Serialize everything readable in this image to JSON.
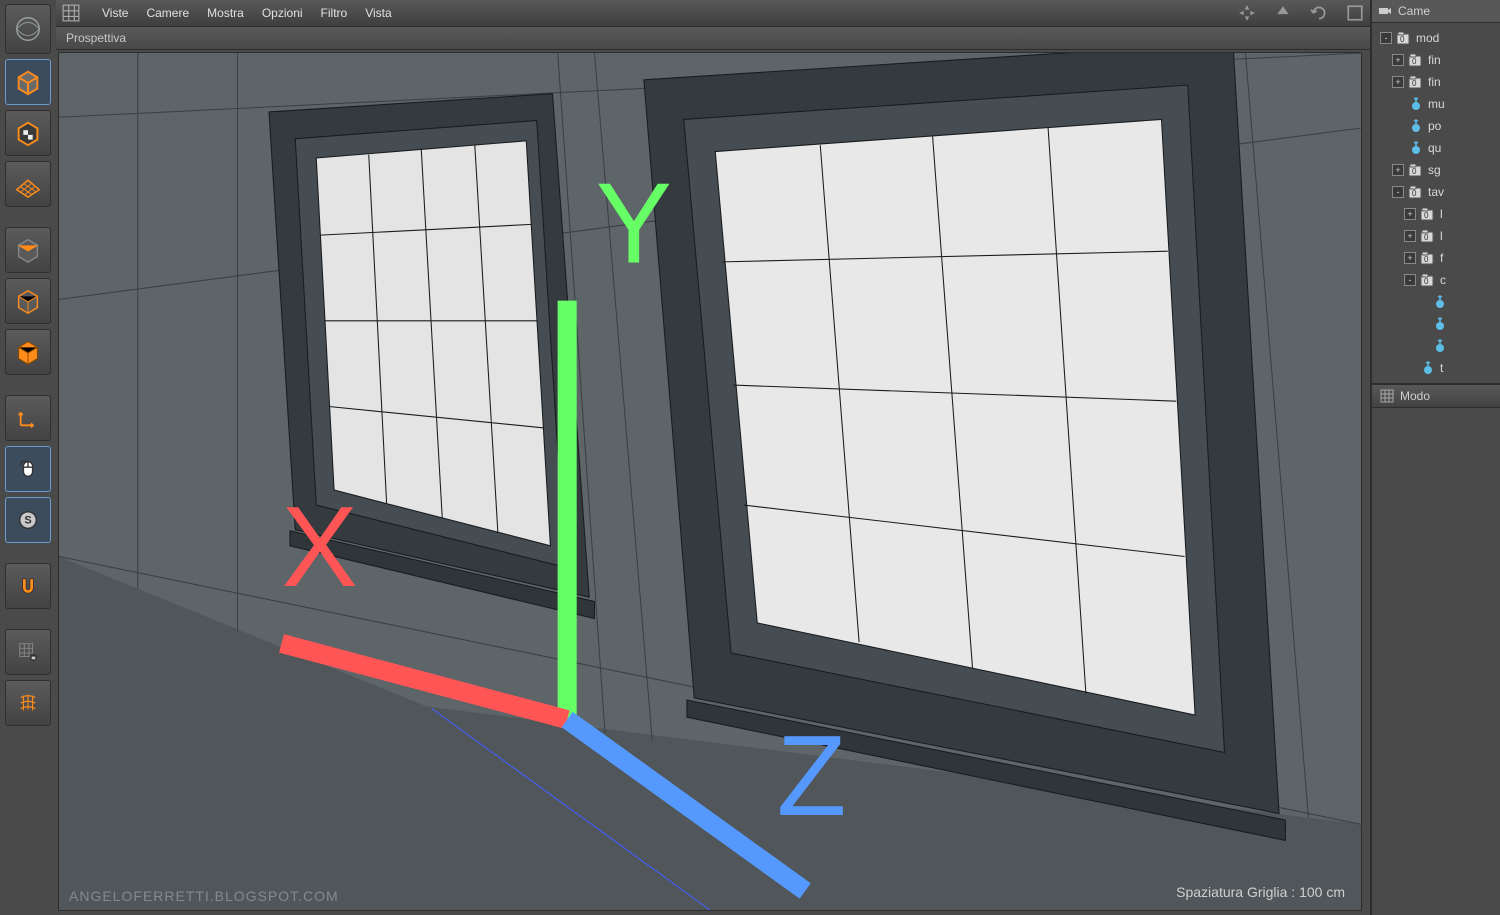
{
  "menu": {
    "items": [
      "Viste",
      "Camere",
      "Mostra",
      "Opzioni",
      "Filtro",
      "Vista"
    ]
  },
  "view_label": "Prospettiva",
  "statusbar": "Spaziatura Griglia : 100 cm",
  "watermark": "ANGELOFERRETTI.BLOGSPOT.COM",
  "gizmo": {
    "x": "X",
    "y": "Y",
    "z": "Z"
  },
  "left_tools": [
    {
      "name": "cube-solid",
      "sel": true
    },
    {
      "name": "cube-checker",
      "sel": false
    },
    {
      "name": "grid-plane",
      "sel": false
    },
    {
      "name": "cube-top",
      "sel": false
    },
    {
      "name": "cube-wire",
      "sel": false
    },
    {
      "name": "cube-orange",
      "sel": false
    }
  ],
  "left_tools2": [
    {
      "name": "axis-icon"
    },
    {
      "name": "mouse-icon"
    },
    {
      "name": "s-ball-icon"
    }
  ],
  "left_tools3": [
    {
      "name": "magnet-icon"
    },
    {
      "name": "grid-lock-icon"
    },
    {
      "name": "grid-wrap-icon"
    }
  ],
  "tree_header": "Came",
  "tree": [
    {
      "ind": 0,
      "exp": "-",
      "ico": "layer",
      "label": "mod"
    },
    {
      "ind": 1,
      "exp": "+",
      "ico": "layer",
      "label": "fin"
    },
    {
      "ind": 1,
      "exp": "+",
      "ico": "layer",
      "label": "fin"
    },
    {
      "ind": 1,
      "exp": "",
      "ico": "null",
      "label": "mu"
    },
    {
      "ind": 1,
      "exp": "",
      "ico": "null",
      "label": "po"
    },
    {
      "ind": 1,
      "exp": "",
      "ico": "null",
      "label": "qu"
    },
    {
      "ind": 1,
      "exp": "+",
      "ico": "layer",
      "label": "sg"
    },
    {
      "ind": 1,
      "exp": "-",
      "ico": "layer",
      "label": "tav"
    },
    {
      "ind": 2,
      "exp": "+",
      "ico": "layer",
      "label": "l"
    },
    {
      "ind": 2,
      "exp": "+",
      "ico": "layer",
      "label": "l"
    },
    {
      "ind": 2,
      "exp": "+",
      "ico": "layer",
      "label": "f"
    },
    {
      "ind": 2,
      "exp": "-",
      "ico": "layer",
      "label": "c"
    },
    {
      "ind": 3,
      "exp": "",
      "ico": "null",
      "label": ""
    },
    {
      "ind": 3,
      "exp": "",
      "ico": "null",
      "label": ""
    },
    {
      "ind": 3,
      "exp": "",
      "ico": "null",
      "label": ""
    },
    {
      "ind": 2,
      "exp": "",
      "ico": "null",
      "label": "t"
    }
  ],
  "modo_label": "Modo"
}
